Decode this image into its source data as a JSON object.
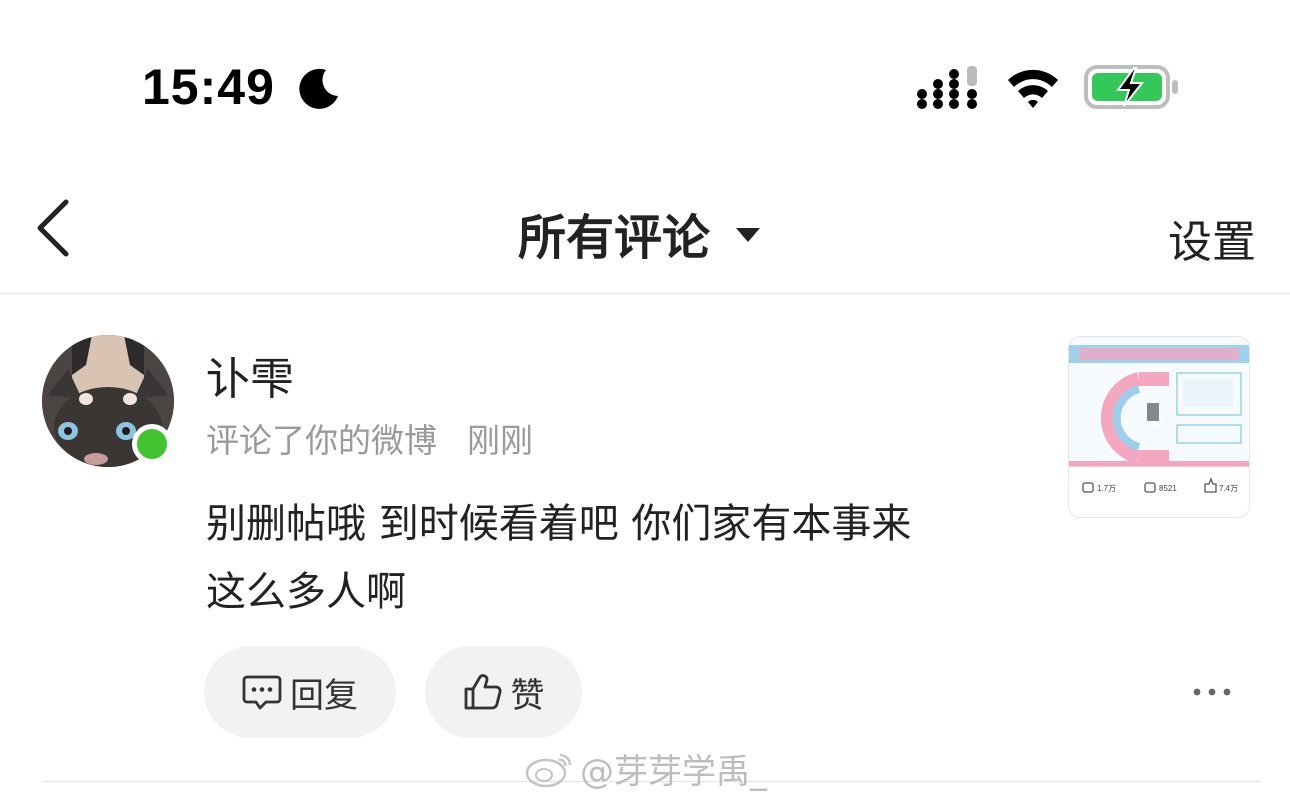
{
  "status_bar": {
    "time": "15:49",
    "icons": [
      "moon-icon",
      "cellular-signal-icon",
      "wifi-icon",
      "battery-charging-icon"
    ]
  },
  "nav": {
    "back_icon": "chevron-left-icon",
    "title": "所有评论",
    "dropdown_icon": "caret-down-icon",
    "settings_label": "设置"
  },
  "comment": {
    "username": "讣雫",
    "action": "评论了你的微博",
    "time": "刚刚",
    "text_line1": "别删帖哦 到时候看着吧 你们家有本事来",
    "text_line2": "这么多人啊",
    "online_color": "#42c431",
    "reply_label": "回复",
    "like_label": "赞",
    "more_icon": "more-dots-icon"
  },
  "thumbnail": {
    "stats": [
      "1.7万",
      "8521",
      "7.4万"
    ]
  },
  "watermark": {
    "text": "@芽芽学禹_"
  }
}
